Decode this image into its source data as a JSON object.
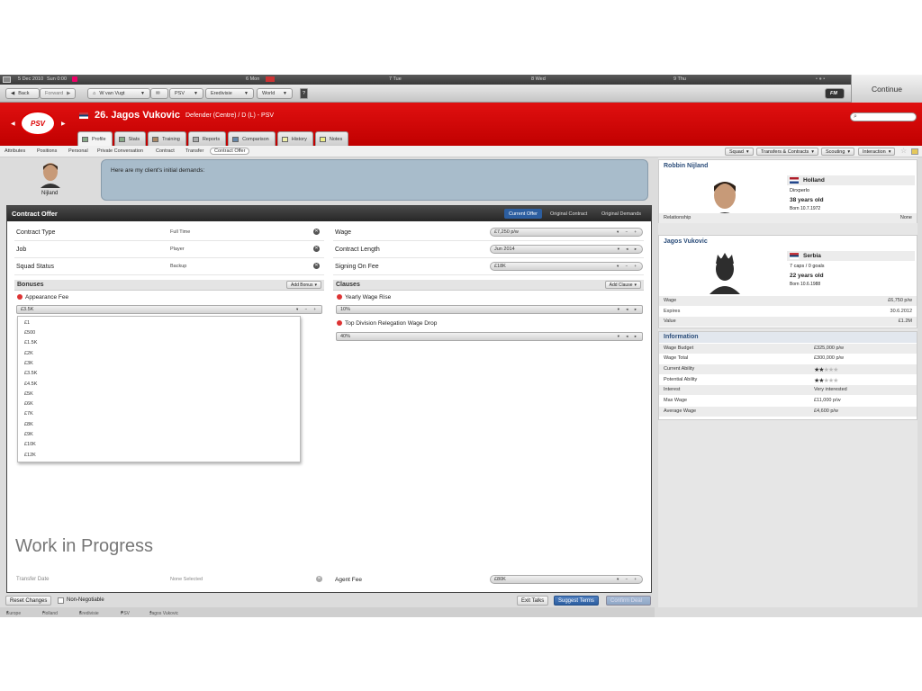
{
  "datebar": {
    "date": "5 Dec 2010",
    "day0": "Sun 0:00",
    "d1": "6 Mon",
    "d2": "7 Tue",
    "d3": "8 Wed",
    "d4": "9 Thu"
  },
  "continue_label": "Continue",
  "nav": {
    "back": "Back",
    "forward": "Forward",
    "manager": "W van Vugt",
    "club": "PSV",
    "league": "Eredivisie",
    "world": "World",
    "help": "?",
    "fm": "FM"
  },
  "header": {
    "club_logo": "PSV",
    "title": "26. Jagos Vukovic",
    "subtitle": "Defender (Centre) / D (L) - PSV",
    "search_placeholder": ""
  },
  "tabs": [
    "Profile",
    "Stats",
    "Training",
    "Reports",
    "Comparison",
    "History",
    "Notes"
  ],
  "subnav": {
    "links": [
      "Attributes",
      "Positions",
      "Personal",
      "Private Conversation",
      "Contract",
      "Transfer",
      "Contract Offer"
    ],
    "buttons": [
      "Squad",
      "Transfers & Contracts",
      "Scouting",
      "Interaction"
    ]
  },
  "agent": {
    "name": "Nijland",
    "message": "Here are my client's initial demands:"
  },
  "contract": {
    "title": "Contract Offer",
    "tabs": [
      "Current Offer",
      "Original Contract",
      "Original Demands"
    ],
    "left_rows": [
      {
        "label": "Contract Type",
        "value": "Full Time"
      },
      {
        "label": "Job",
        "value": "Player"
      },
      {
        "label": "Squad Status",
        "value": "Backup"
      }
    ],
    "right_rows": [
      {
        "label": "Wage",
        "value": "£7,250 p/w"
      },
      {
        "label": "Contract Length",
        "value": "Jun 2014"
      },
      {
        "label": "Signing On Fee",
        "value": "£18K"
      }
    ],
    "bonuses": {
      "title": "Bonuses",
      "add": "Add Bonus",
      "item": "Appearance Fee",
      "value": "£3.5K"
    },
    "clauses": {
      "title": "Clauses",
      "add": "Add Clause",
      "items": [
        {
          "label": "Yearly Wage Rise",
          "value": "10%"
        },
        {
          "label": "Top Division Relegation Wage Drop",
          "value": "40%"
        }
      ]
    },
    "dropdown_options": [
      "£1",
      "£500",
      "£1.5K",
      "£2K",
      "£3K",
      "£3.5K",
      "£4.5K",
      "£5K",
      "£6K",
      "£7K",
      "£8K",
      "£9K",
      "£10K",
      "£12K"
    ],
    "watermark": "Work in Progress",
    "transfer_date": {
      "label": "Transfer Date",
      "value": "None Selected"
    },
    "agent_fee": {
      "label": "Agent Fee",
      "value": "£80K"
    }
  },
  "bottom": {
    "reset": "Reset Changes",
    "non_negotiable": "Non-Negotiable",
    "exit": "Exit Talks",
    "suggest": "Suggest Terms",
    "confirm": "Confirm Deal"
  },
  "breadcrumbs": [
    "Europe",
    "Holland",
    "Eredivisie",
    "PSV",
    "Jagos Vukovic"
  ],
  "agent_card": {
    "name": "Robbin Nijland",
    "nation": "Holland",
    "city": "Dirxperlo",
    "age": "38 years old",
    "born": "Born 10.7.1972",
    "relationship_label": "Relationship",
    "relationship_value": "None"
  },
  "player_card": {
    "name": "Jagos Vukovic",
    "nation": "Serbia",
    "caps": "7 caps / 0 goals",
    "age": "22 years old",
    "born": "Born 10.6.1988",
    "rows": [
      {
        "k": "Wage",
        "v": "£6,750 p/w"
      },
      {
        "k": "Expires",
        "v": "30.6.2012"
      },
      {
        "k": "Value",
        "v": "£1.2M"
      }
    ]
  },
  "info": {
    "title": "Information",
    "rows": [
      {
        "k": "Wage Budget",
        "v": "£325,000 p/w"
      },
      {
        "k": "Wage Total",
        "v": "£300,000 p/w"
      },
      {
        "k": "Current Ability",
        "v": ""
      },
      {
        "k": "Potential Ability",
        "v": ""
      },
      {
        "k": "Interest",
        "v": "Very interested"
      },
      {
        "k": "Max Wage",
        "v": "£11,000 p/w"
      },
      {
        "k": "Average Wage",
        "v": "£4,600 p/w"
      }
    ],
    "current_ability_stars": 2,
    "potential_ability_stars": 2,
    "stars_max": 5
  },
  "colors": {
    "header_red": "#d00000",
    "accent_blue": "#2c5ea0",
    "bubble": "#a8bccb"
  }
}
